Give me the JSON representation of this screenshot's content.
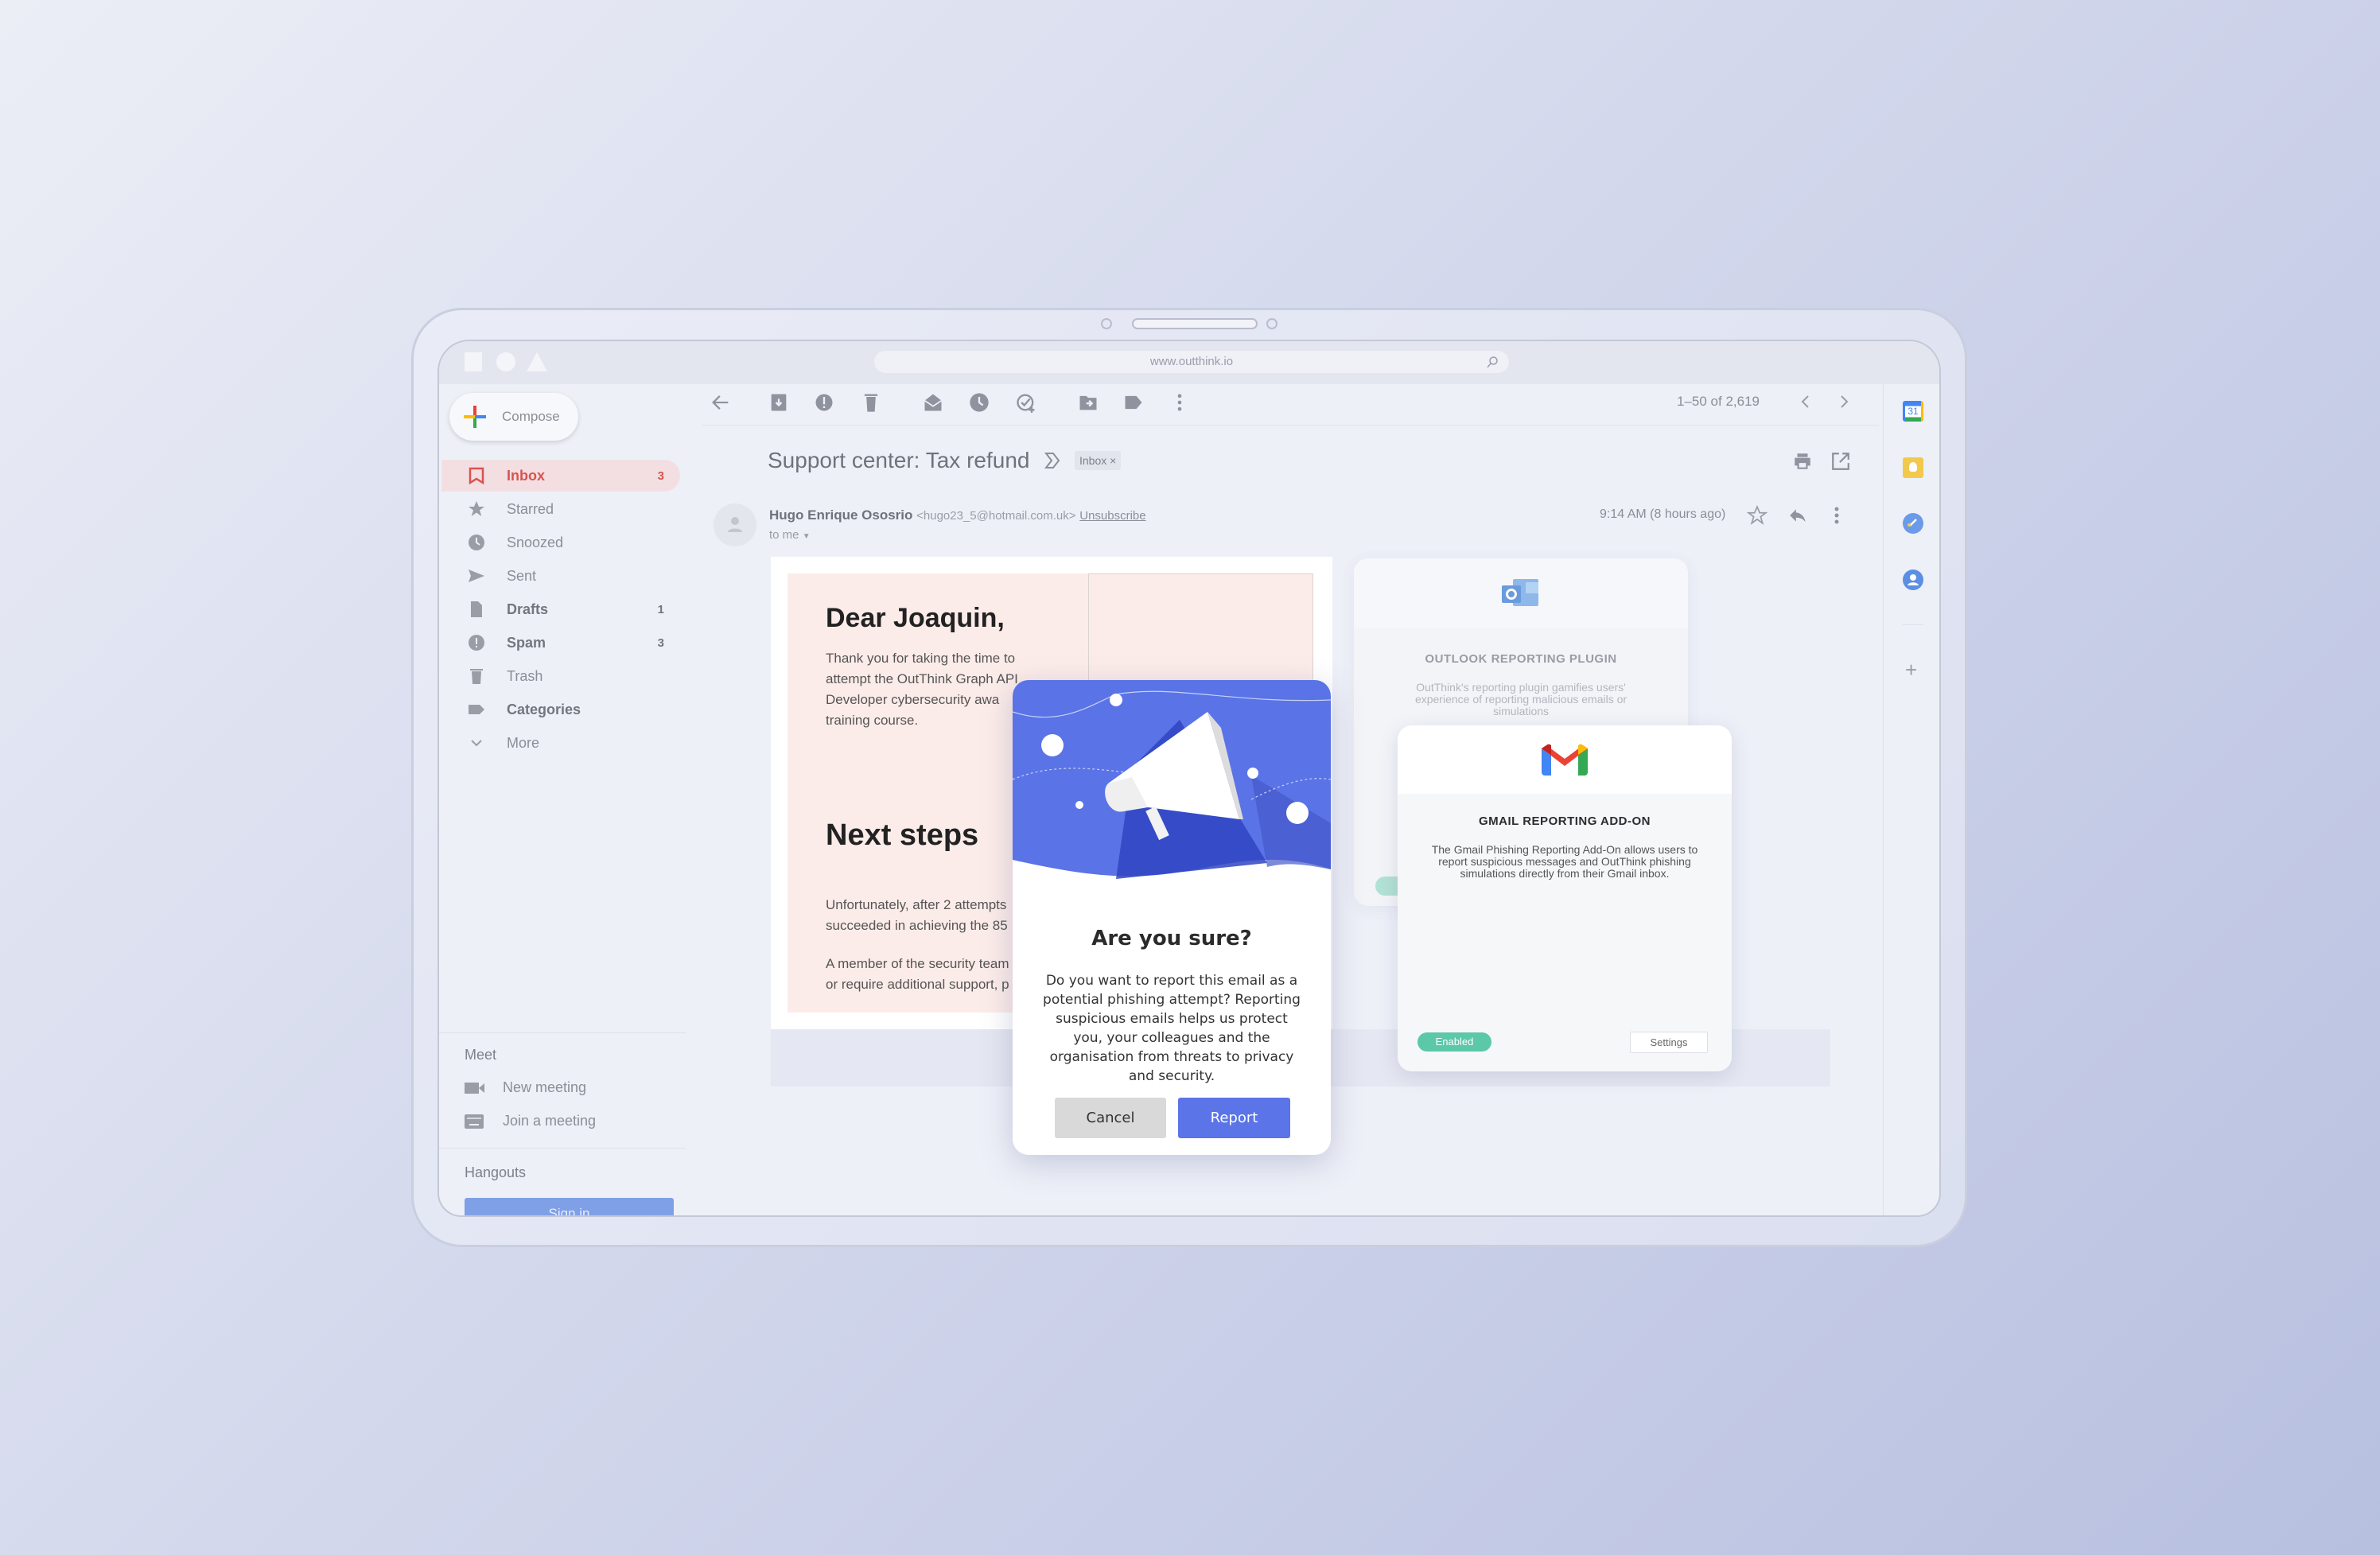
{
  "browser": {
    "url": "www.outthink.io"
  },
  "sidebar": {
    "compose": "Compose",
    "items": [
      {
        "label": "Inbox",
        "count": "3",
        "icon": "inbox-icon"
      },
      {
        "label": "Starred",
        "count": "",
        "icon": "star-icon"
      },
      {
        "label": "Snoozed",
        "count": "",
        "icon": "clock-icon"
      },
      {
        "label": "Sent",
        "count": "",
        "icon": "send-icon"
      },
      {
        "label": "Drafts",
        "count": "1",
        "icon": "draft-icon"
      },
      {
        "label": "Spam",
        "count": "3",
        "icon": "spam-icon"
      },
      {
        "label": "Trash",
        "count": "",
        "icon": "trash-icon"
      },
      {
        "label": "Categories",
        "count": "",
        "icon": "label-icon"
      },
      {
        "label": "More",
        "count": "",
        "icon": "chevron-down-icon"
      }
    ],
    "meet": {
      "title": "Meet",
      "new_meeting": "New meeting",
      "join_meeting": "Join a meeting"
    },
    "hangouts": {
      "title": "Hangouts",
      "sign_in": "Sign in"
    }
  },
  "toolbar": {
    "pagination": "1–50 of 2,619"
  },
  "email": {
    "subject": "Support center: Tax refund",
    "label": "Inbox",
    "label_close": "×",
    "sender_name": "Hugo Enrique Ososrio",
    "sender_email": "<hugo23_5@hotmail.com.uk>",
    "unsubscribe": "Unsubscribe",
    "to": "to me",
    "time": "9:14 AM (8 hours ago)",
    "body": {
      "greeting": "Dear Joaquin,",
      "para1": [
        "Thank you for taking the time to",
        "attempt the OutThink Graph API",
        "Developer cybersecurity awa",
        "training course."
      ],
      "heading2": "Next steps",
      "para2": [
        "Unfortunately, after 2 attempts",
        "succeeded in achieving the 85"
      ],
      "para3": [
        "A member of the security team",
        "or require additional support, p"
      ]
    }
  },
  "outlook_card": {
    "title": "OUTLOOK REPORTING PLUGIN",
    "description": "OutThink's reporting plugin gamifies users' experience of reporting malicious emails or simulations"
  },
  "gmail_card": {
    "title": "GMAIL REPORTING ADD-ON",
    "description": "The Gmail Phishing Reporting Add-On allows users to report suspicious messages and OutThink phishing simulations directly from their Gmail inbox.",
    "status": "Enabled",
    "settings": "Settings"
  },
  "modal": {
    "title": "Are you sure?",
    "body": "Do you want to report this email as a potential phishing attempt? Reporting suspicious emails helps us protect you, your colleagues and the organisation from threats to privacy and security.",
    "cancel": "Cancel",
    "report": "Report"
  },
  "right_rail": {
    "calendar_day": "31"
  },
  "colors": {
    "accent": "#5b74e8",
    "inbox_active": "#d9534f",
    "enabled": "#5bc8a8",
    "modal_header": "#5a73e6"
  }
}
